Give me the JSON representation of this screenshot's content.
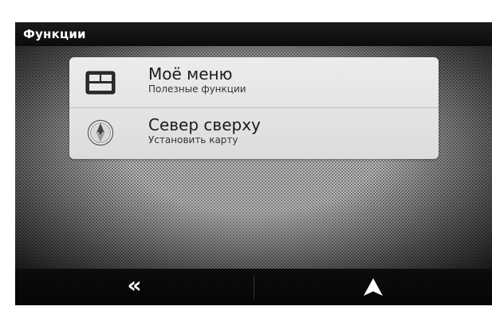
{
  "titlebar": {
    "title": "Функции"
  },
  "menu": {
    "items": [
      {
        "title": "Моё меню",
        "subtitle": "Полезные функции",
        "icon": "my-menu-grid-icon"
      },
      {
        "title": "Север сверху",
        "subtitle": "Установить карту",
        "icon": "compass-north-up-icon"
      }
    ]
  },
  "bottombar": {
    "back_glyph": "«",
    "back_icon": "double-chevron-left-icon",
    "navigation_icon": "navigation-arrow-icon"
  },
  "colors": {
    "titlebar_bg": "#111111",
    "panel_bg": "#e6e6e6",
    "content_texture": "#b7b7b7"
  }
}
